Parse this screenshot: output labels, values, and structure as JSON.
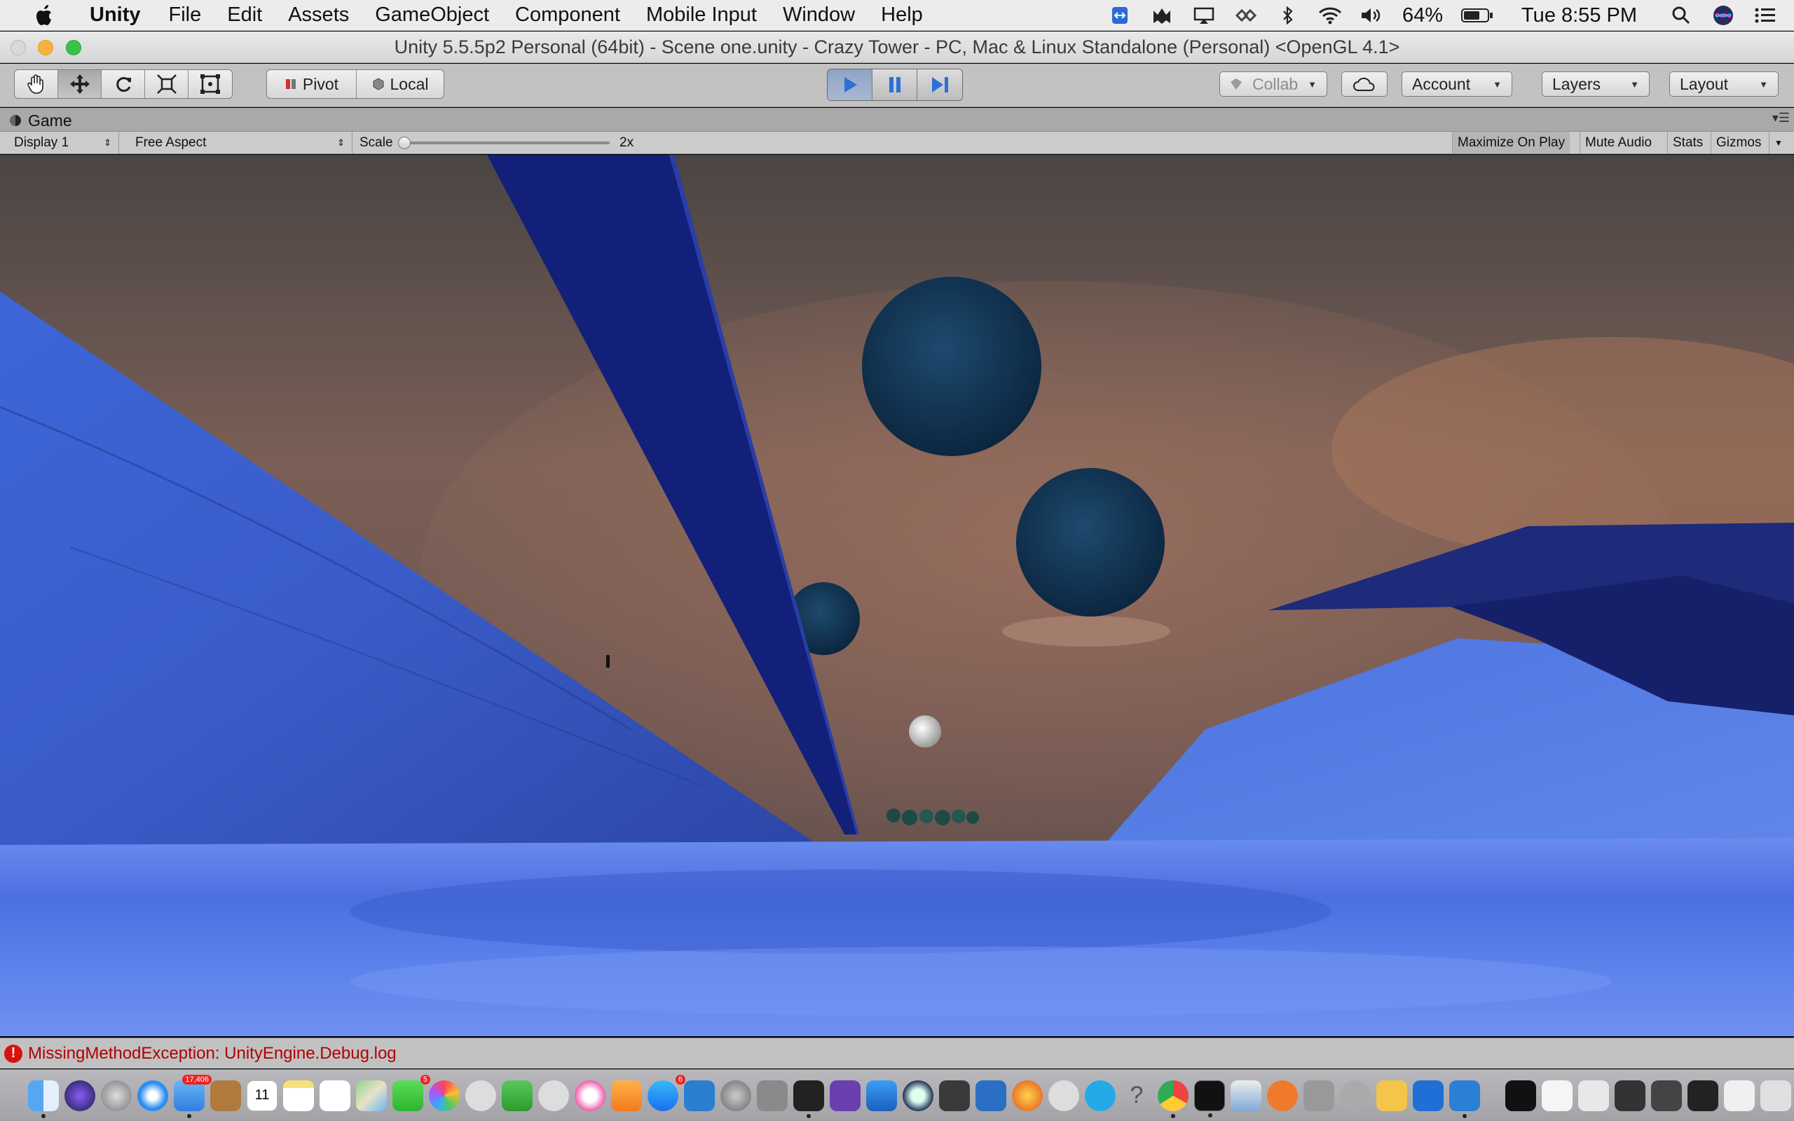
{
  "menubar": {
    "app_name": "Unity",
    "items": [
      "File",
      "Edit",
      "Assets",
      "GameObject",
      "Component",
      "Mobile Input",
      "Window",
      "Help"
    ],
    "battery": "64%",
    "clock": "Tue 8:55 PM"
  },
  "window": {
    "title": "Unity 5.5.5p2 Personal (64bit) - Scene one.unity - Crazy Tower - PC, Mac & Linux Standalone (Personal) <OpenGL 4.1>"
  },
  "toolbar": {
    "pivot_label": "Pivot",
    "local_label": "Local",
    "collab_label": "Collab",
    "account_label": "Account",
    "layers_label": "Layers",
    "layout_label": "Layout"
  },
  "game_view": {
    "tab_label": "Game",
    "display_label": "Display 1",
    "aspect_label": "Free Aspect",
    "scale_label": "Scale",
    "scale_value": "2x",
    "maximize_label": "Maximize On Play",
    "mute_label": "Mute Audio",
    "stats_label": "Stats",
    "gizmos_label": "Gizmos"
  },
  "status": {
    "message": "MissingMethodException: UnityEngine.Debug.log"
  },
  "dock": {
    "icons": [
      "finder-icon",
      "siri-icon",
      "launchpad-icon",
      "safari-icon",
      "mail-icon",
      "notes-book-icon",
      "calendar-icon",
      "notes-icon",
      "reminders-icon",
      "maps-icon",
      "photos-icon",
      "messages-icon",
      "facetime-icon",
      "itunes-icon",
      "ibooks-icon",
      "app-store-icon",
      "system-preferences-icon",
      "unity-icon",
      "visual-studio-icon",
      "xcode-icon",
      "firefox-icon",
      "skype-icon",
      "chrome-icon",
      "terminal-icon",
      "preview-icon",
      "unity-hub-icon",
      "vscode-icon",
      "trash-icon"
    ],
    "badges": {
      "mail": "17,406",
      "calendar": "11",
      "facetime": "5",
      "app_store": "6"
    }
  },
  "colors": {
    "play_accent": "#2f6fd6",
    "error_red": "#d9120c"
  }
}
